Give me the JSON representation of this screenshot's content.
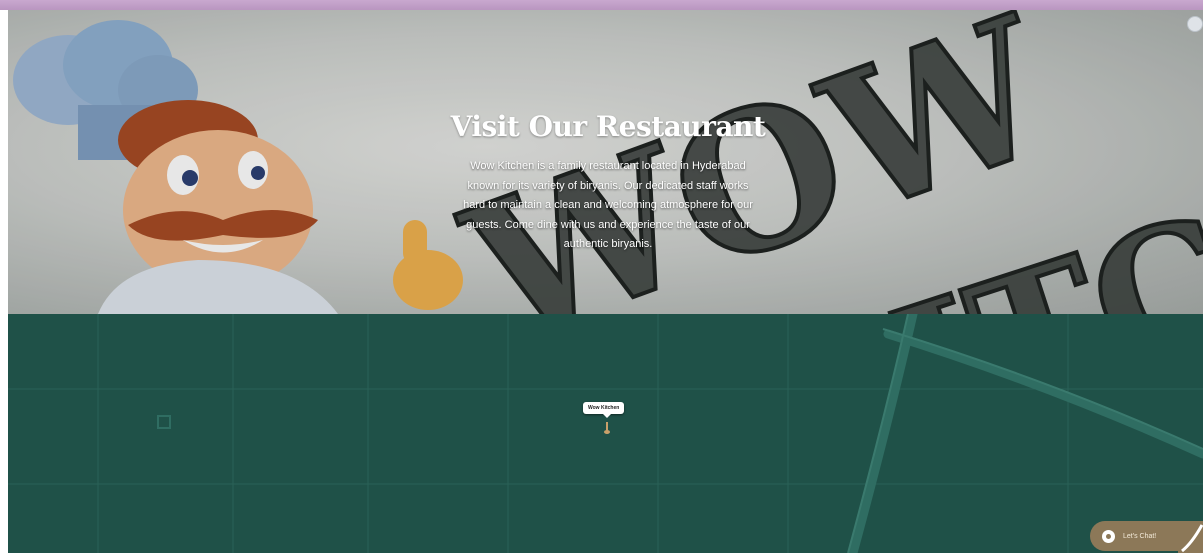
{
  "hero": {
    "background_letters": [
      "WOW",
      "KITCHEN"
    ],
    "title": "Visit Our Restaurant",
    "description": "Wow Kitchen is a family restaurant located in Hyderabad known for its variety of biryanis. Our dedicated staff works hard to maintain a clean and welcoming atmosphere for our guests. Come dine with us and experience the taste of our authentic biryanis."
  },
  "map": {
    "marker_label": "Wow Kitchen",
    "background_color": "#1f5148",
    "road_color": "#2e6b60"
  },
  "chat": {
    "label": "Let's Chat!",
    "color": "#8c7858"
  },
  "colors": {
    "top_bar": "#c9a8cf",
    "title_text": "#ffffff"
  }
}
